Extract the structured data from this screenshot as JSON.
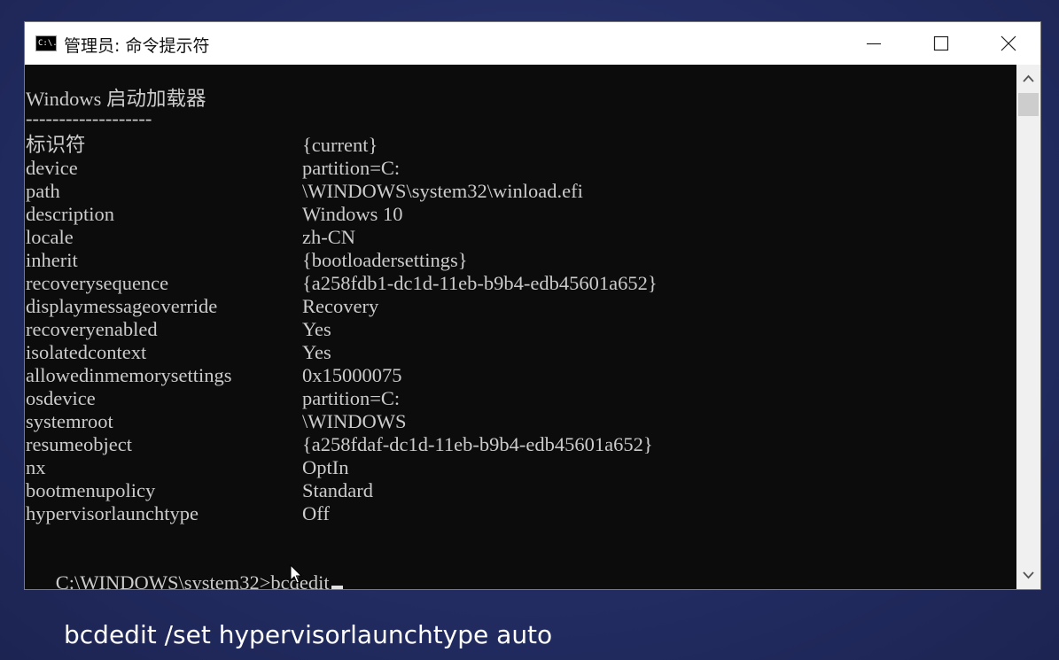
{
  "window": {
    "title": "管理员: 命令提示符",
    "icon": "cmd-icon",
    "icon_text": "C:\\."
  },
  "console": {
    "heading": "Windows 启动加载器",
    "separator": "-------------------",
    "entries": [
      {
        "key": "标识符",
        "value": "{current}"
      },
      {
        "key": "device",
        "value": "partition=C:"
      },
      {
        "key": "path",
        "value": "\\WINDOWS\\system32\\winload.efi"
      },
      {
        "key": "description",
        "value": "Windows 10"
      },
      {
        "key": "locale",
        "value": "zh-CN"
      },
      {
        "key": "inherit",
        "value": "{bootloadersettings}"
      },
      {
        "key": "recoverysequence",
        "value": "{a258fdb1-dc1d-11eb-b9b4-edb45601a652}"
      },
      {
        "key": "displaymessageoverride",
        "value": "Recovery"
      },
      {
        "key": "recoveryenabled",
        "value": "Yes"
      },
      {
        "key": "isolatedcontext",
        "value": "Yes"
      },
      {
        "key": "allowedinmemorysettings",
        "value": "0x15000075"
      },
      {
        "key": "osdevice",
        "value": "partition=C:"
      },
      {
        "key": "systemroot",
        "value": "\\WINDOWS"
      },
      {
        "key": "resumeobject",
        "value": "{a258fdaf-dc1d-11eb-b9b4-edb45601a652}"
      },
      {
        "key": "nx",
        "value": "OptIn"
      },
      {
        "key": "bootmenupolicy",
        "value": "Standard"
      },
      {
        "key": "hypervisorlaunchtype",
        "value": "Off"
      }
    ],
    "prompt": "C:\\WINDOWS\\system32>bcdedit"
  },
  "caption": "bcdedit /set hypervisorlaunchtype auto",
  "colors": {
    "console_bg": "#0c0c0c",
    "console_text": "#cccccc",
    "background": "#232d63"
  }
}
